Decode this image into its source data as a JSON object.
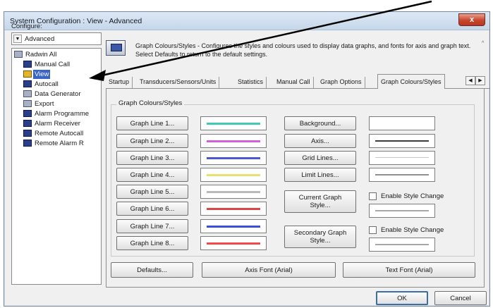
{
  "window": {
    "title": "System Configuration : View - Advanced",
    "close_label": "x"
  },
  "configure": {
    "label": "Configure:",
    "selected": "Advanced"
  },
  "tree": {
    "root": "Radwin All",
    "items": [
      {
        "label": "Manual Call",
        "icon": "network-icon"
      },
      {
        "label": "View",
        "icon": "view-icon",
        "selected": true
      },
      {
        "label": "Autocall",
        "icon": "network-icon"
      },
      {
        "label": "Data Generator",
        "icon": "generator-icon"
      },
      {
        "label": "Export",
        "icon": "export-icon"
      },
      {
        "label": "Alarm Programme",
        "icon": "network-icon"
      },
      {
        "label": "Alarm Receiver",
        "icon": "network-icon"
      },
      {
        "label": "Remote Autocall",
        "icon": "network-icon"
      },
      {
        "label": "Remote Alarm R",
        "icon": "network-icon"
      }
    ]
  },
  "header": {
    "description": "Graph Colours/Styles - Configures the styles and colours used to display data graphs, and fonts for axis and graph text. Select Defaults to return to the default settings.",
    "scroll_glyph": "^"
  },
  "tabs": [
    {
      "label": "Startup",
      "active": false
    },
    {
      "label": "Transducers/Sensors/Units",
      "active": false
    },
    {
      "label": "Statistics",
      "active": false
    },
    {
      "label": "Manual Call",
      "active": false
    },
    {
      "label": "Graph Options",
      "active": false
    },
    {
      "label": "Graph Colours/Styles",
      "active": true
    }
  ],
  "tab_scroll": {
    "left": "◀",
    "right": "▶"
  },
  "group": {
    "label": "Graph Colours/Styles",
    "graph_lines": [
      {
        "label": "Graph Line 1...",
        "color": "#40c8b8"
      },
      {
        "label": "Graph Line 2...",
        "color": "#d060d8"
      },
      {
        "label": "Graph Line 3...",
        "color": "#4a58d0"
      },
      {
        "label": "Graph Line 4...",
        "color": "#e8e070"
      },
      {
        "label": "Graph Line 5...",
        "color": "#b8b8b8"
      },
      {
        "label": "Graph Line 6...",
        "color": "#d84848"
      },
      {
        "label": "Graph Line 7...",
        "color": "#3a4ee0"
      },
      {
        "label": "Graph Line 8...",
        "color": "#f04a4a"
      }
    ],
    "background_label": "Background...",
    "axis_label": "Axis...",
    "grid_lines_label": "Grid Lines...",
    "limit_lines_label": "Limit Lines...",
    "current_graph_style_label": "Current Graph Style...",
    "secondary_graph_style_label": "Secondary Graph Style...",
    "enable_style_change_1": "Enable Style Change",
    "enable_style_change_2": "Enable Style Change"
  },
  "footer_buttons": {
    "defaults": "Defaults...",
    "axis_font": "Axis Font (Arial)",
    "text_font": "Text Font (Arial)"
  },
  "dialog_buttons": {
    "ok": "OK",
    "cancel": "Cancel"
  }
}
